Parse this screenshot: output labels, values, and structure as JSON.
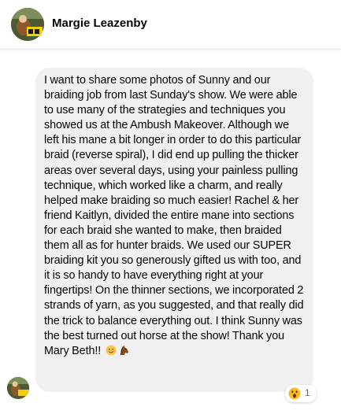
{
  "sender": {
    "name": "Margie Leazenby"
  },
  "message": {
    "text": "I want to share some photos of Sunny and our braiding job from last Sunday's show. We were able to use many of the strategies and techniques you showed us at the Ambush Makeover. Although we left his mane a bit longer in order to do this particular braid (reverse spiral), I did end up pulling the thicker areas over several days, using your painless pulling technique, which worked like a charm, and really helped make braiding so much easier! Rachel & her friend Kaitlyn, divided the entire mane into sections for each braid she wanted to make, then braided them all as for hunter braids. We used our SUPER braiding kit you so generously gifted us with too, and it is so handy to have everything right at your fingertips! On the thinner sections, we incorporated 2 strands of yarn, as you suggested, and that really did the trick to balance everything out. I think Sunny was the best turned out horse at the show! Thank you Mary Beth!!",
    "trailing_emojis": [
      "smiling-face-icon",
      "horse-face-icon"
    ]
  },
  "reaction": {
    "icon": "wow-reaction-icon",
    "count": "1"
  }
}
